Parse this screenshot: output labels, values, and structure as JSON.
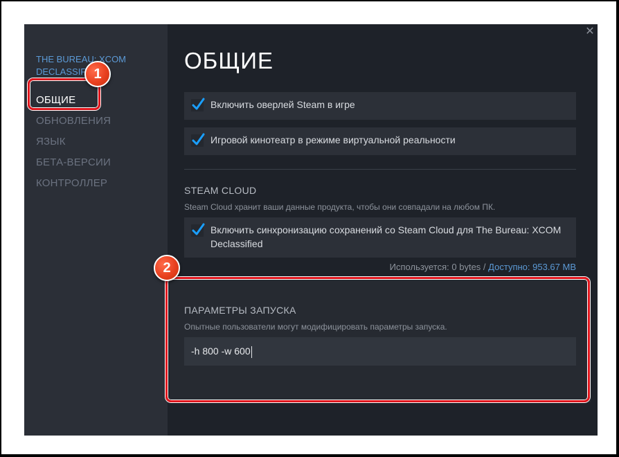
{
  "sidebar": {
    "game_title": "THE BUREAU: XCOM DECLASSIFIED",
    "items": [
      {
        "label": "ОБЩИЕ",
        "active": true
      },
      {
        "label": "ОБНОВЛЕНИЯ",
        "active": false
      },
      {
        "label": "ЯЗЫК",
        "active": false
      },
      {
        "label": "БЕТА-ВЕРСИИ",
        "active": false
      },
      {
        "label": "КОНТРОЛЛЕР",
        "active": false
      }
    ]
  },
  "window": {
    "close_icon": "close-icon"
  },
  "main": {
    "title": "ОБЩИЕ",
    "options": [
      {
        "label": "Включить оверлей Steam в игре",
        "checked": true
      },
      {
        "label": "Игровой кинотеатр в режиме виртуальной реальности",
        "checked": true
      }
    ],
    "steam_cloud": {
      "title": "STEAM CLOUD",
      "description": "Steam Cloud хранит ваши данные продукта, чтобы они совпадали на любом ПК.",
      "sync_label": "Включить синхронизацию сохранений со Steam Cloud для The Bureau: XCOM Declassified",
      "sync_checked": true,
      "used": "Используется: 0 bytes",
      "separator": "/",
      "available": "Доступно: 953.67 MB"
    },
    "launch": {
      "title": "ПАРАМЕТРЫ ЗАПУСКА",
      "description": "Опытные пользователи могут модифицировать параметры запуска.",
      "value": "-h 800 -w 600"
    }
  },
  "annotations": {
    "marker_1": "1",
    "marker_2": "2"
  },
  "colors": {
    "accent": "#1a9fff",
    "link": "#5c9ad6",
    "highlight": "#e0161d",
    "marker": "#e8401f"
  }
}
